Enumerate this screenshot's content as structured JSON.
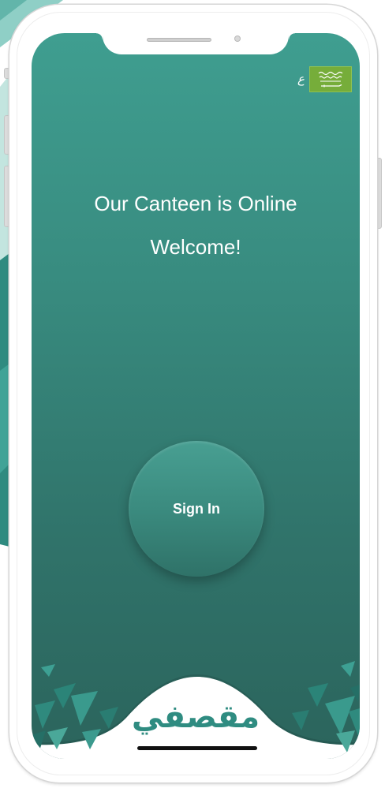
{
  "app": {
    "language_toggle_label": "ع",
    "headline": "Our Canteen is Online",
    "welcome_text": "Welcome!",
    "sign_in_label": "Sign In",
    "logo_text": "مقصفي"
  },
  "icons": {
    "language_flag": "saudi-flag-icon",
    "notch_speaker": "speaker-icon",
    "notch_camera": "camera-icon"
  },
  "colors": {
    "brand_teal": "#2f8c81",
    "screen_top": "#3f9e90",
    "screen_bottom": "#2b645c",
    "flag_green": "#76ad3a",
    "text": "#ffffff"
  }
}
